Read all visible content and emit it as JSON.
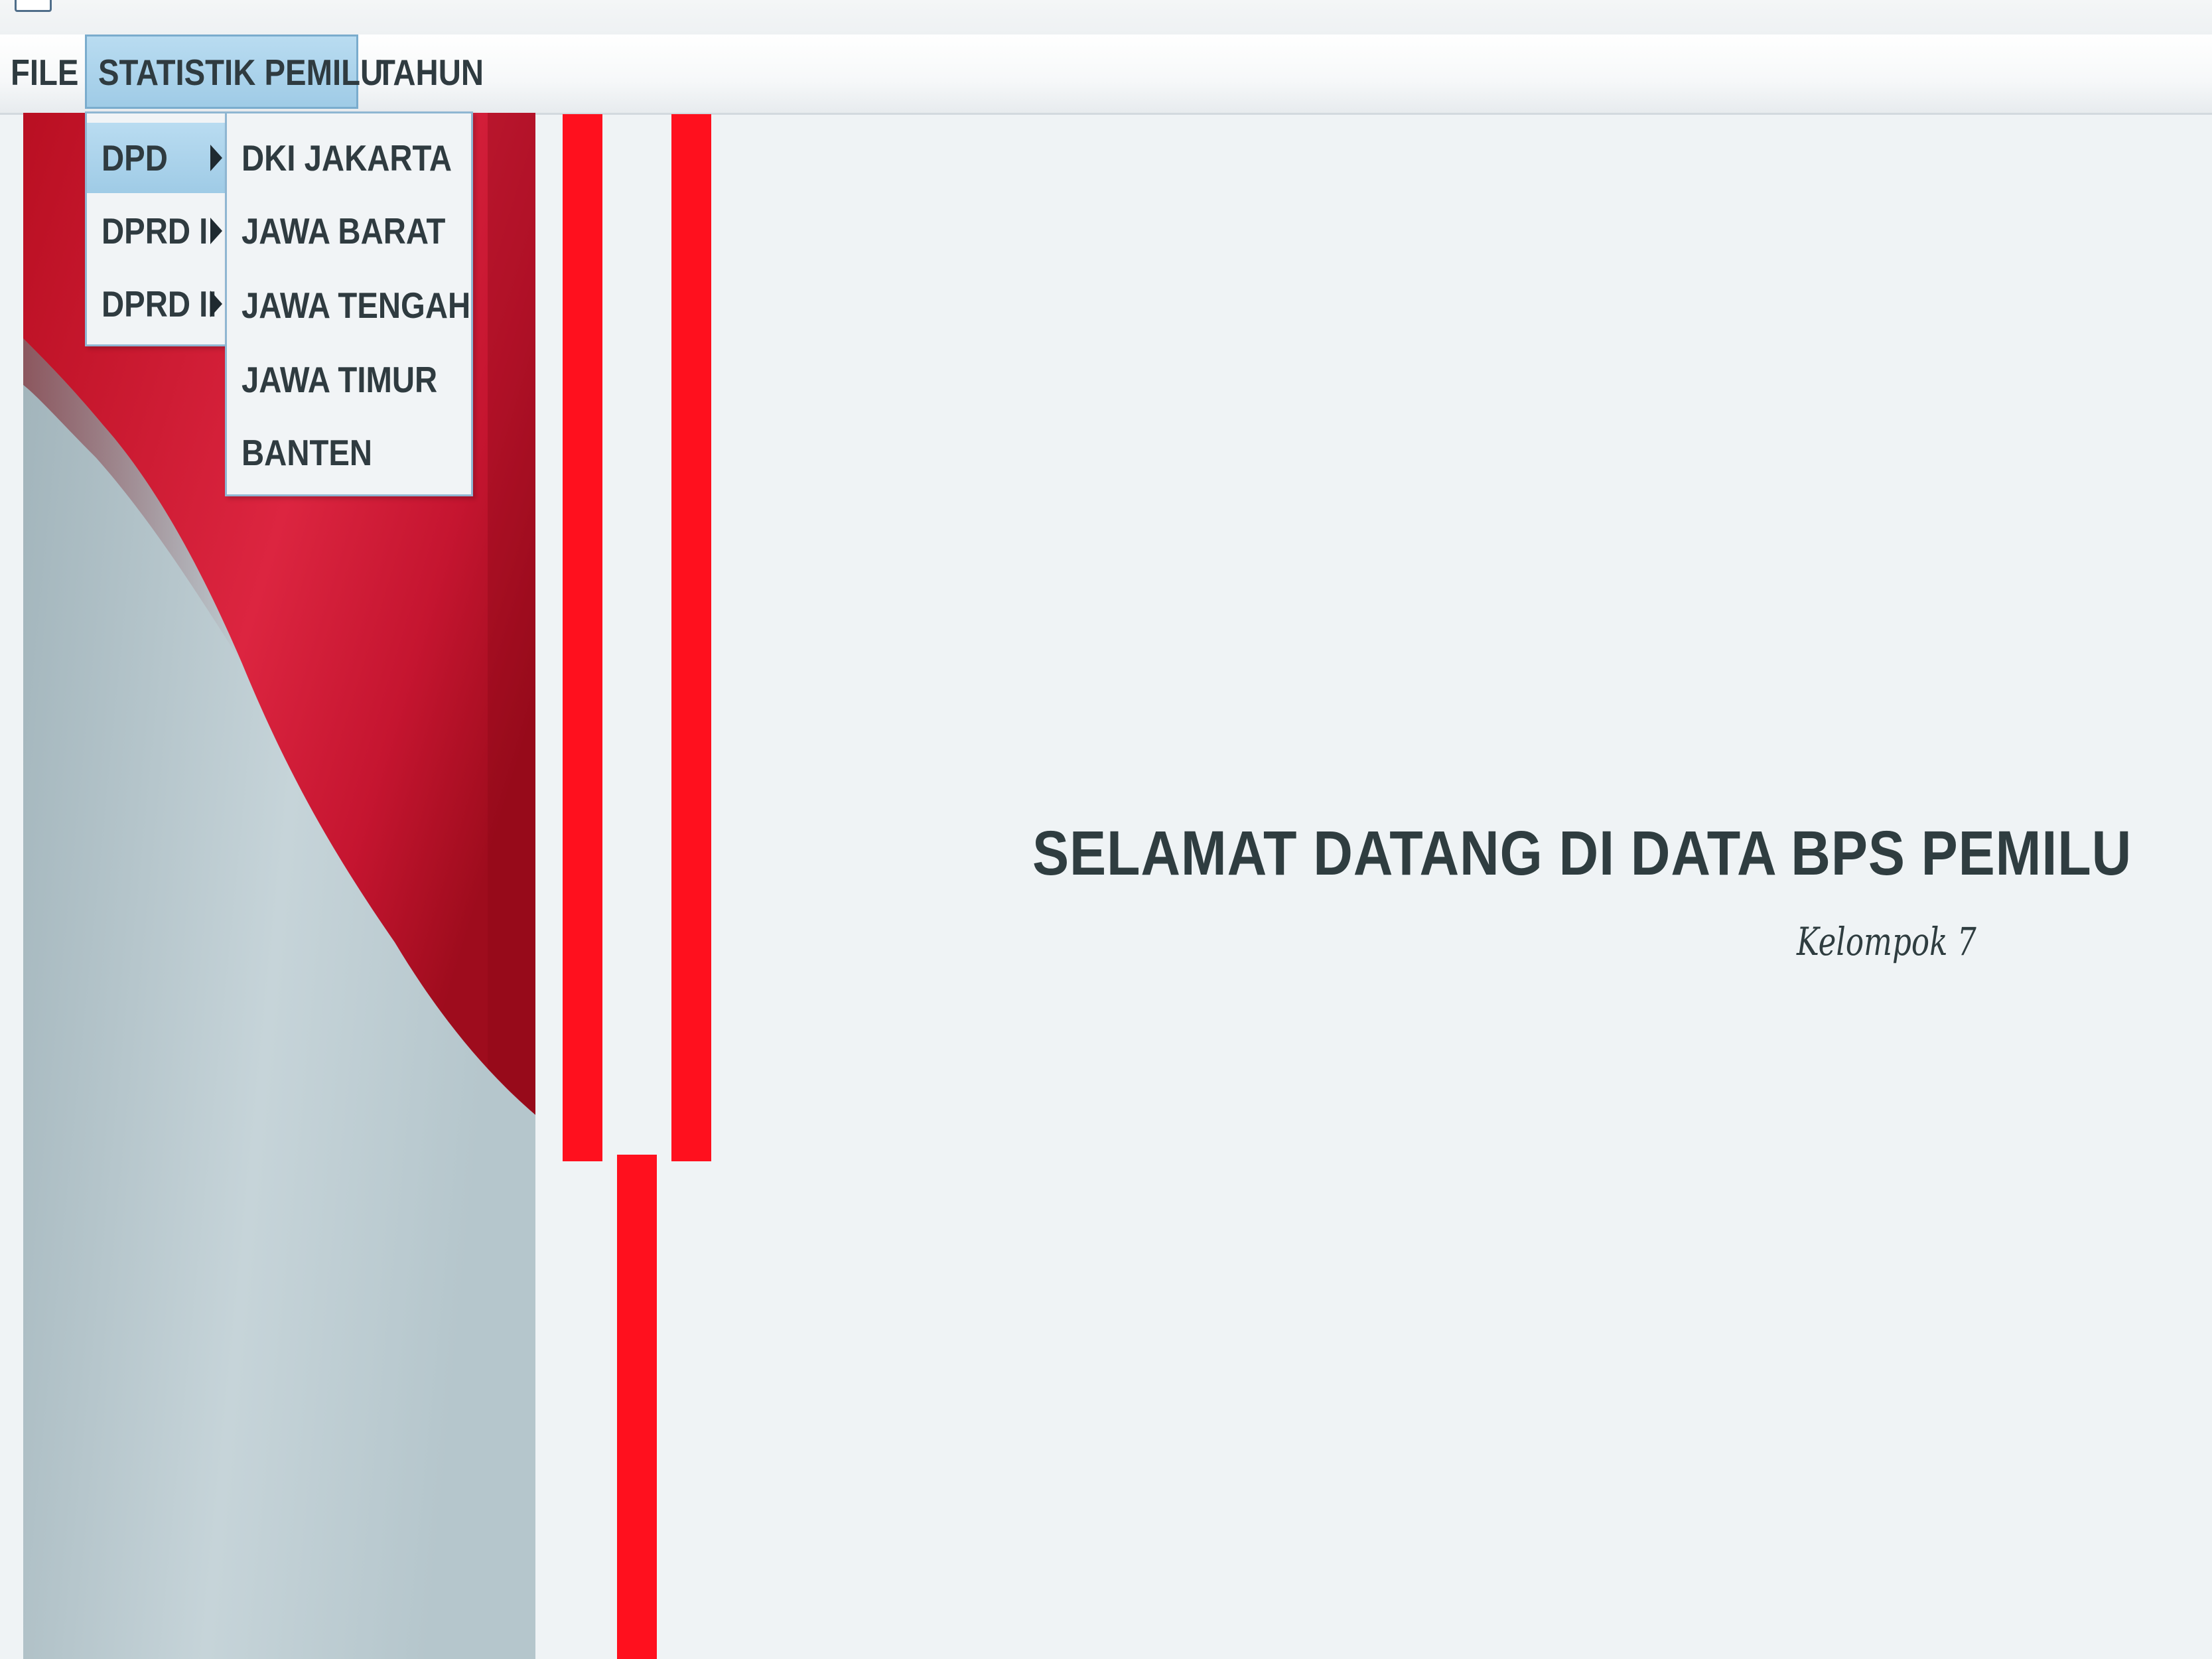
{
  "menubar": {
    "items": [
      {
        "label": "FILE"
      },
      {
        "label": "STATISTIK PEMILU"
      },
      {
        "label": "TAHUN"
      }
    ]
  },
  "menu_statistik": {
    "items": [
      {
        "label": "DPD",
        "selected": true,
        "has_submenu": true
      },
      {
        "label": "DPRD I",
        "has_submenu": true
      },
      {
        "label": "DPRD II",
        "has_submenu": true
      }
    ]
  },
  "submenu_dpd": {
    "items": [
      {
        "label": "DKI JAKARTA"
      },
      {
        "label": "JAWA BARAT"
      },
      {
        "label": "JAWA TENGAH"
      },
      {
        "label": "JAWA TIMUR"
      },
      {
        "label": "BANTEN"
      }
    ]
  },
  "main": {
    "welcome_title": "SELAMAT DATANG DI DATA BPS PEMILU",
    "subtitle": "Kelompok 7"
  },
  "colors": {
    "accent_red": "#ff101e",
    "menu_highlight": "#a9d3ec",
    "text_dark": "#2f3b40"
  }
}
